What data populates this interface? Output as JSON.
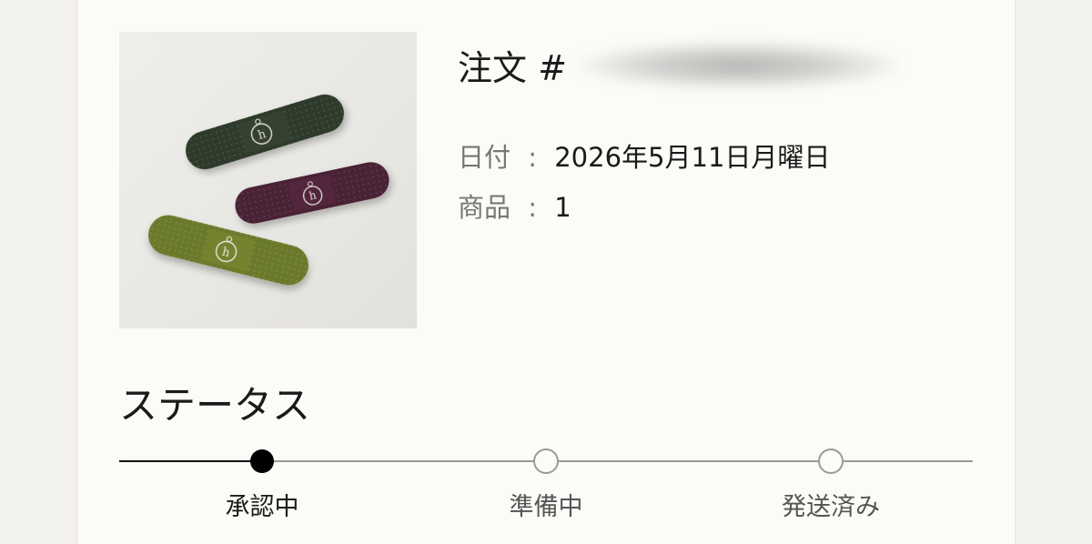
{
  "order": {
    "title_prefix": "注文 #",
    "date_label": "日付",
    "date_value": "2026年5月11日月曜日",
    "items_label": "商品",
    "items_value": "1",
    "separator": ":"
  },
  "status": {
    "heading": "ステータス",
    "current_index": 0,
    "steps": [
      {
        "label": "承認中"
      },
      {
        "label": "準備中"
      },
      {
        "label": "発送済み"
      }
    ]
  },
  "product_image": {
    "items": [
      {
        "icon": "bandage-dark-green",
        "color": "#2f3a2c"
      },
      {
        "icon": "bandage-plum",
        "color": "#4a2236"
      },
      {
        "icon": "bandage-olive",
        "color": "#6b7a2a"
      }
    ]
  },
  "colors": {
    "active_dot": "#000000",
    "inactive_line": "#9a9a9a",
    "active_line": "#111111"
  }
}
